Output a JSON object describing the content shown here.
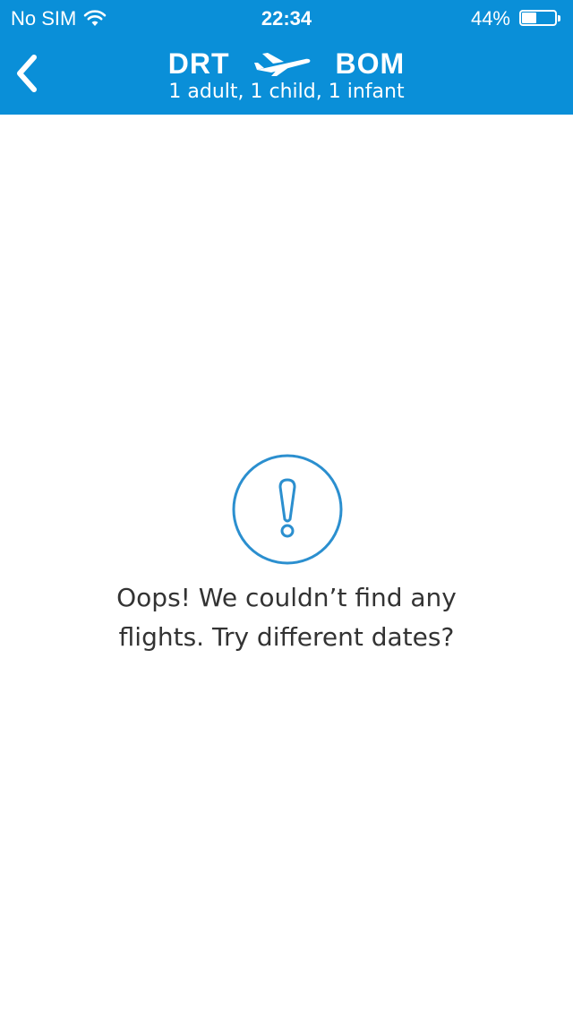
{
  "status_bar": {
    "carrier": "No SIM",
    "time": "22:34",
    "battery_percent": "44%",
    "battery_level": 0.44,
    "wifi_icon": "wifi-icon",
    "battery_icon": "battery-icon"
  },
  "header": {
    "origin": "DRT",
    "destination": "BOM",
    "passengers": "1 adult, 1 child, 1 infant",
    "back_icon": "chevron-left-icon",
    "route_icon": "airplane-icon",
    "background_color": "#0a8fd8"
  },
  "empty_state": {
    "icon": "exclamation-circle-icon",
    "message_line1": "Oops! We couldn’t find any",
    "message_line2": "flights. Try different dates?",
    "icon_color": "#2b8fcf",
    "text_color": "#333333"
  }
}
